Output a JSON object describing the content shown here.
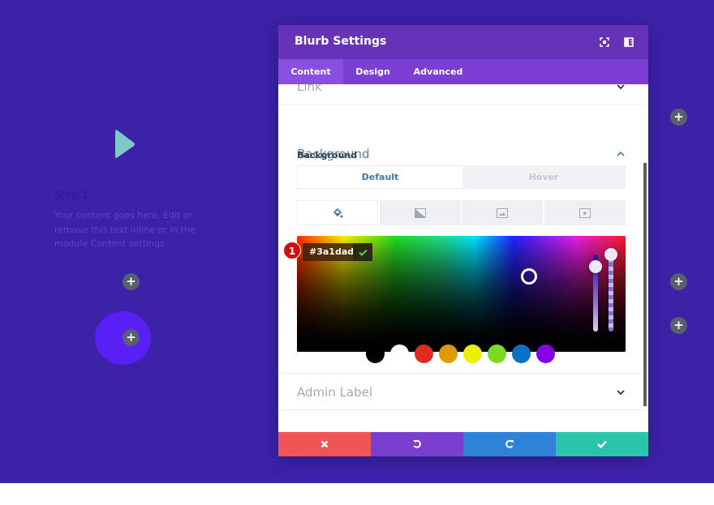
{
  "page": {
    "background_color": "#3b22a8",
    "blurb": {
      "title": "Step 1",
      "body": "Your content goes here. Edit or remove this text inline or in the module Content settings",
      "icon": "play-arrow-icon",
      "icon_color": "#7ec8c8"
    },
    "add_buttons": [
      "+",
      "+",
      "+",
      "+",
      "+"
    ]
  },
  "modal": {
    "title": "Blurb Settings",
    "header_icons": [
      "fullscreen-icon",
      "split-view-icon"
    ],
    "tabs": [
      {
        "label": "Content",
        "active": true
      },
      {
        "label": "Design",
        "active": false
      },
      {
        "label": "Advanced",
        "active": false
      }
    ],
    "sections": {
      "link": {
        "title": "Link",
        "expanded": false
      },
      "background": {
        "title": "Background",
        "expanded": true,
        "field_label": "Background",
        "states": [
          {
            "label": "Default",
            "active": true
          },
          {
            "label": "Hover",
            "active": false
          }
        ],
        "types": [
          {
            "name": "color",
            "icon": "paint-bucket-icon",
            "active": true
          },
          {
            "name": "gradient",
            "icon": "gradient-icon",
            "active": false
          },
          {
            "name": "image",
            "icon": "image-icon",
            "active": false
          },
          {
            "name": "video",
            "icon": "video-icon",
            "active": false
          }
        ],
        "color_picker": {
          "hex_value": "#3a1dad",
          "badge": "1",
          "swatches": [
            "#000000",
            "#ffffff",
            "#e02b20",
            "#e09900",
            "#edf000",
            "#7cda24",
            "#0c71c3",
            "#8300e9"
          ]
        }
      },
      "admin_label": {
        "title": "Admin Label",
        "expanded": false
      }
    },
    "footer": {
      "buttons": [
        {
          "name": "cancel",
          "icon": "close-icon",
          "color": "#ef5555"
        },
        {
          "name": "undo",
          "icon": "undo-icon",
          "color": "#7b3fcf"
        },
        {
          "name": "redo",
          "icon": "redo-icon",
          "color": "#2e83d9"
        },
        {
          "name": "save",
          "icon": "check-icon",
          "color": "#29c4a9"
        }
      ]
    }
  }
}
